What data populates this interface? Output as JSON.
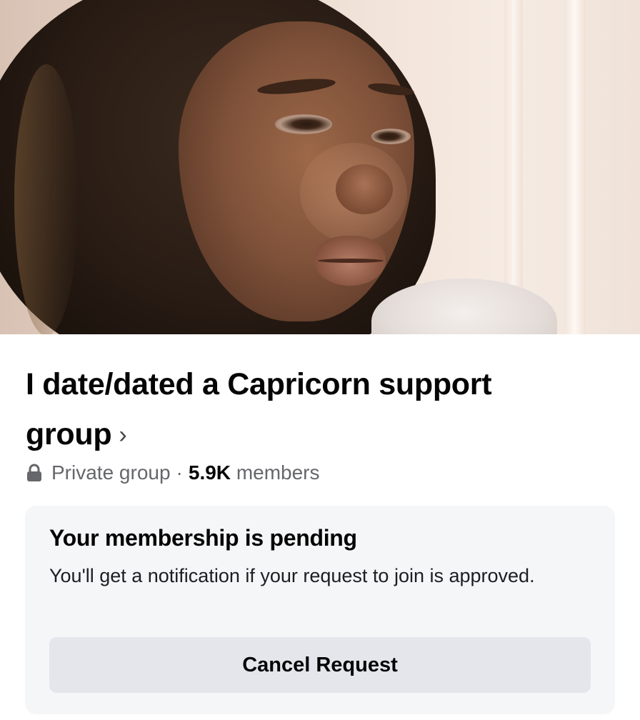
{
  "group": {
    "title": "I date/dated a Capricorn support group",
    "chevron": "›",
    "privacy_label": "Private group",
    "separator": "·",
    "member_count": "5.9K",
    "members_label": "members"
  },
  "membership": {
    "status_title": "Your membership is pending",
    "status_description": "You'll get a notification if your request to join is approved.",
    "cancel_label": "Cancel Request"
  },
  "icons": {
    "privacy": "lock-icon",
    "navigate": "chevron-right-icon"
  },
  "colors": {
    "text_primary": "#050505",
    "text_secondary": "#65676b",
    "card_background": "#f5f6f8",
    "button_background": "#e4e6eb"
  }
}
